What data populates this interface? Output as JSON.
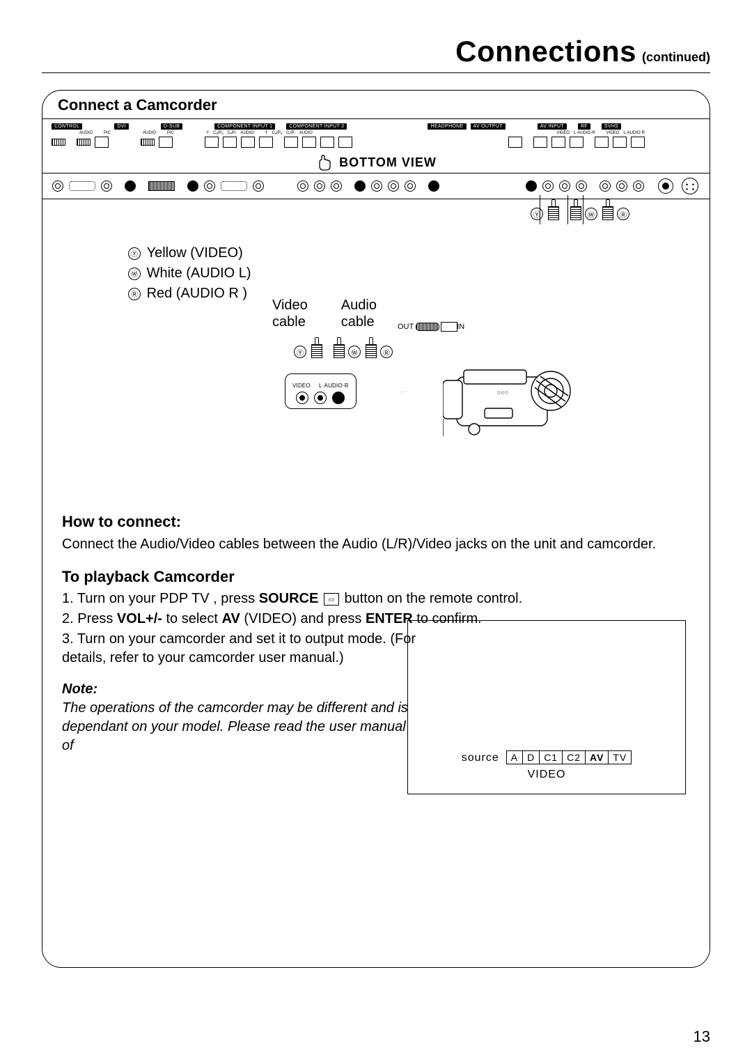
{
  "header": {
    "title": "Connections",
    "continued": "(continued)"
  },
  "section": {
    "title": "Connect a Camcorder"
  },
  "panel_labels": {
    "control": "CONTROL",
    "dvi": "DVI",
    "dsub": "D-SUB",
    "audio": "AUDIO",
    "pic": "PIC",
    "comp1": "COMPONENT INPUT 1",
    "comp2": "COMPONENT INPUT 2",
    "y": "Y",
    "cbpb": "Cₐ/Pₐ",
    "crpr": "Cᵣ/Pᵣ",
    "headphone": "HEADPHONE",
    "avout": "AV OUTPUT",
    "avin": "AV INPUT",
    "video": "VIDEO",
    "laudior": "L·AUDIO·R",
    "rf": "RF",
    "svhs": "SVHS"
  },
  "bottom_view": "BOTTOM VIEW",
  "legend": {
    "y_mark": "Ⓨ",
    "y_text": "Yellow (VIDEO)",
    "w_mark": "Ⓦ",
    "w_text": "White (AUDIO L)",
    "r_mark": "Ⓡ",
    "r_text": "Red (AUDIO R )"
  },
  "cable_labels": {
    "video_l1": "Video",
    "video_l2": "cable",
    "audio_l1": "Audio",
    "audio_l2": "cable"
  },
  "outin": {
    "out": "OUT",
    "in": "IN"
  },
  "rca_module": {
    "video": "VIDEO",
    "laudior": "L·AUDIO·R"
  },
  "plug_marks": {
    "y": "Ⓨ",
    "w": "Ⓦ",
    "r": "Ⓡ"
  },
  "how_to": {
    "heading": "How to connect:",
    "line": "Connect the Audio/Video cables between the Audio (L/R)/Video jacks on the unit and camcorder."
  },
  "playback": {
    "heading": "To playback Camcorder",
    "step1_a": "1. Turn on your PDP TV , press ",
    "step1_b": "SOURCE",
    "step1_c": " button on the remote control.",
    "step2_a": "2. Press ",
    "step2_b": "VOL+/-",
    "step2_c": " to select ",
    "step2_d": "AV",
    "step2_e": " (VIDEO) and press ",
    "step2_f": "ENTER",
    "step2_g": " to confirm.",
    "step3": "3. Turn on your camcorder and set it to output mode. (For details, refer to your camcorder user manual.)"
  },
  "note": {
    "label": "Note:",
    "line1": "The operations of the camcorder may be different and is",
    "line2": "dependant on your model. Please read the user manual of"
  },
  "osd": {
    "source_label": "source",
    "items": [
      "A",
      "D",
      "C1",
      "C2",
      "AV",
      "TV"
    ],
    "selected_index": 4,
    "sub": "VIDEO"
  },
  "page_number": "13"
}
